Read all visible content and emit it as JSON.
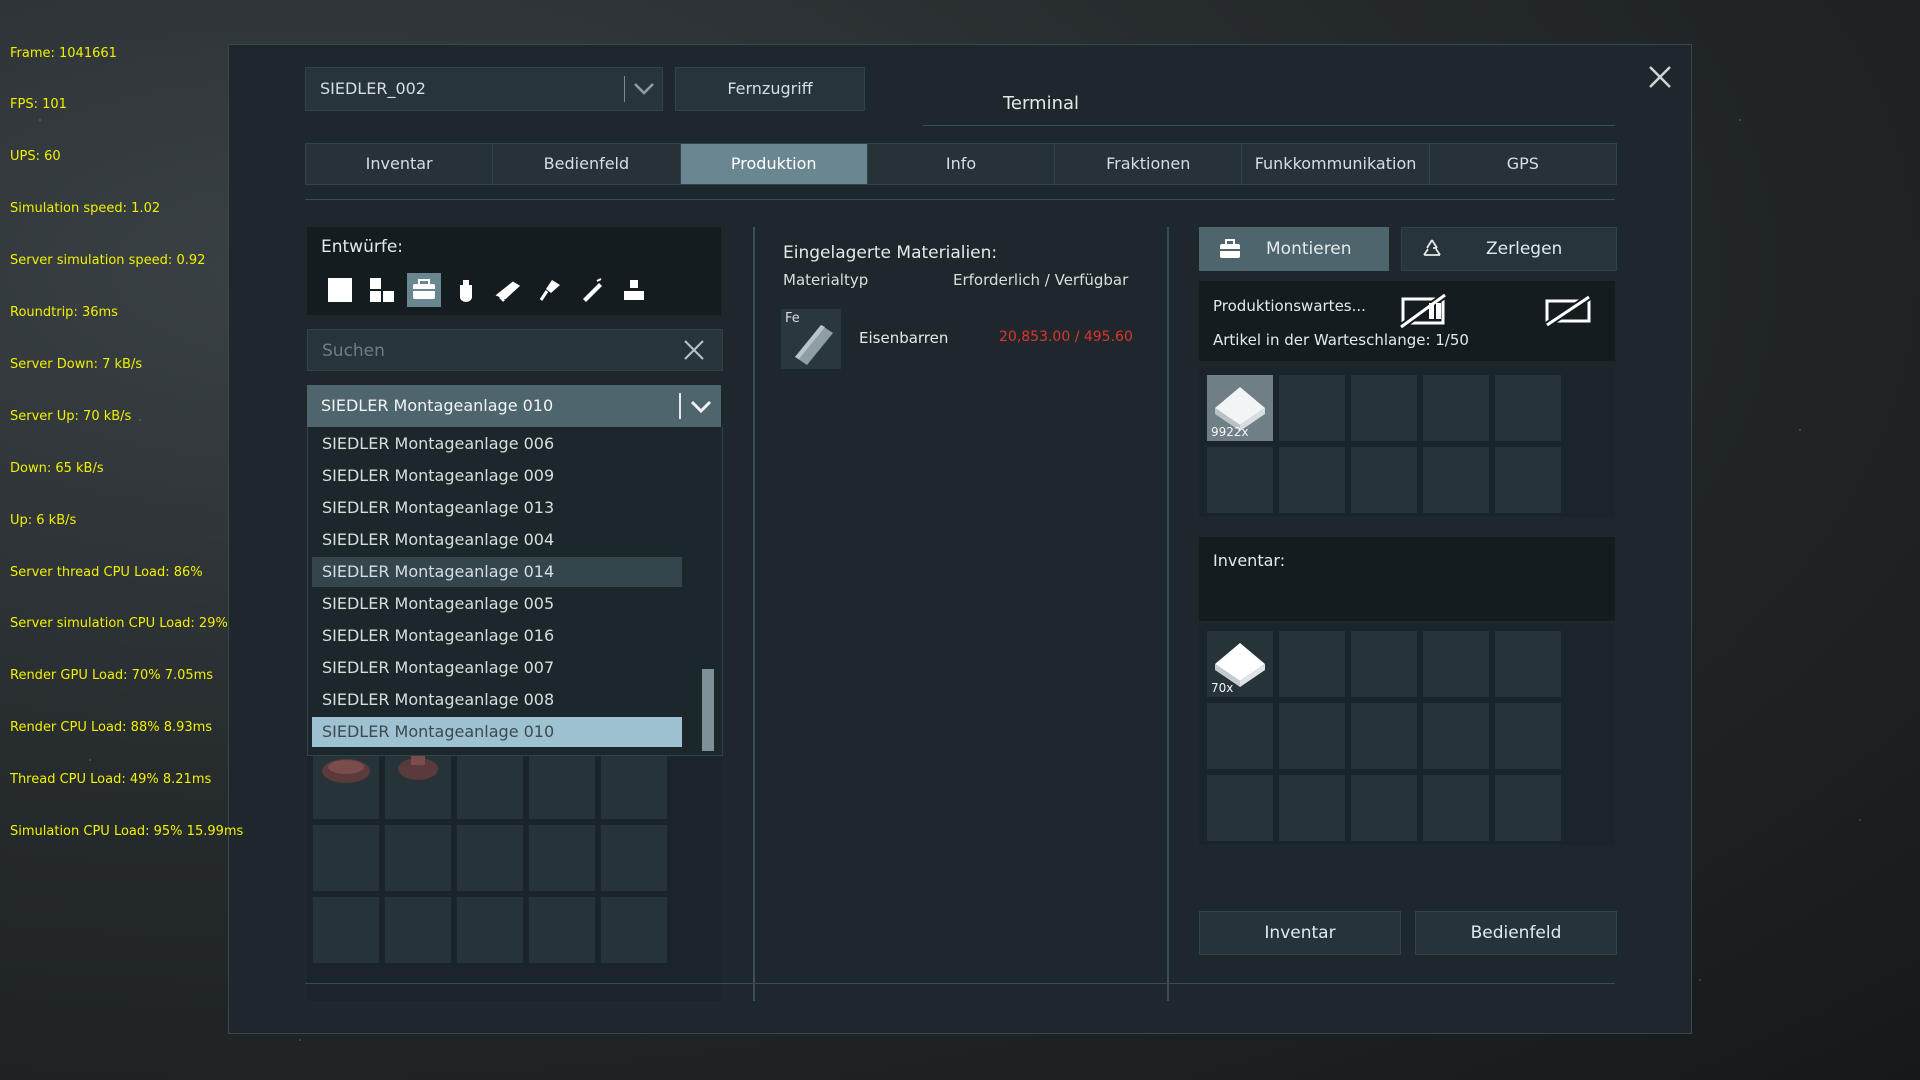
{
  "debug": [
    "Frame: 1041661",
    "FPS: 101",
    "UPS: 60",
    "Simulation speed: 1.02",
    "Server simulation speed: 0.92",
    "Roundtrip: 36ms",
    "Server Down: 7 kB/s",
    "Server Up: 70 kB/s",
    "Down: 65 kB/s",
    "Up: 6 kB/s",
    "Server thread CPU Load: 86%",
    "Server simulation CPU Load: 29%",
    "Render GPU Load: 70% 7.05ms",
    "Render CPU Load: 88% 8.93ms",
    "Thread CPU Load: 49% 8.21ms",
    "Simulation CPU Load: 95% 15.99ms"
  ],
  "header": {
    "grid_selector": "SIEDLER_002",
    "remote_button": "Fernzugriff",
    "title": "Terminal"
  },
  "tabs": [
    {
      "label": "Inventar"
    },
    {
      "label": "Bedienfeld"
    },
    {
      "label": "Produktion",
      "active": true
    },
    {
      "label": "Info"
    },
    {
      "label": "Fraktionen"
    },
    {
      "label": "Funkkommunikation"
    },
    {
      "label": "GPS"
    }
  ],
  "blueprints": {
    "title": "Entwürfe:",
    "category_icons": [
      "all-blocks-icon",
      "large-blocks-icon",
      "components-icon",
      "tools-icon",
      "weapons-icon",
      "drill-icon",
      "welder-icon",
      "characters-icon"
    ],
    "selected_category": 2,
    "search_placeholder": "Suchen"
  },
  "assembler": {
    "selected": "SIEDLER Montageanlage 010",
    "options": [
      "SIEDLER Montageanlage 006",
      "SIEDLER Montageanlage 009",
      "SIEDLER Montageanlage 013",
      "SIEDLER Montageanlage 004",
      "SIEDLER Montageanlage 014",
      "SIEDLER Montageanlage 005",
      "SIEDLER Montageanlage 016",
      "SIEDLER Montageanlage 007",
      "SIEDLER Montageanlage 008",
      "SIEDLER Montageanlage 010"
    ],
    "hover_index": 4,
    "selected_index": 9
  },
  "materials": {
    "title": "Eingelagerte Materialien:",
    "col_type": "Materialtyp",
    "col_amount": "Erforderlich / Verfügbar",
    "rows": [
      {
        "symbol": "Fe",
        "name": "Eisenbarren",
        "amount": "20,853.00 / 495.60"
      }
    ]
  },
  "actions": {
    "assemble": "Montieren",
    "disassemble": "Zerlegen"
  },
  "queue": {
    "title": "Produktionswartes...",
    "count": "Artikel in der Warteschlange: 1/50",
    "items": [
      {
        "count": "9922x"
      }
    ]
  },
  "inventory": {
    "title": "Inventar:",
    "items": [
      {
        "count": "70x"
      }
    ]
  },
  "footer": {
    "inventory_button": "Inventar",
    "control_panel_button": "Bedienfeld"
  },
  "colors": {
    "accent": "#6a8690",
    "selected_item": "#9fc2d2",
    "debug_text": "#f0f000",
    "warning": "#e0342c"
  }
}
